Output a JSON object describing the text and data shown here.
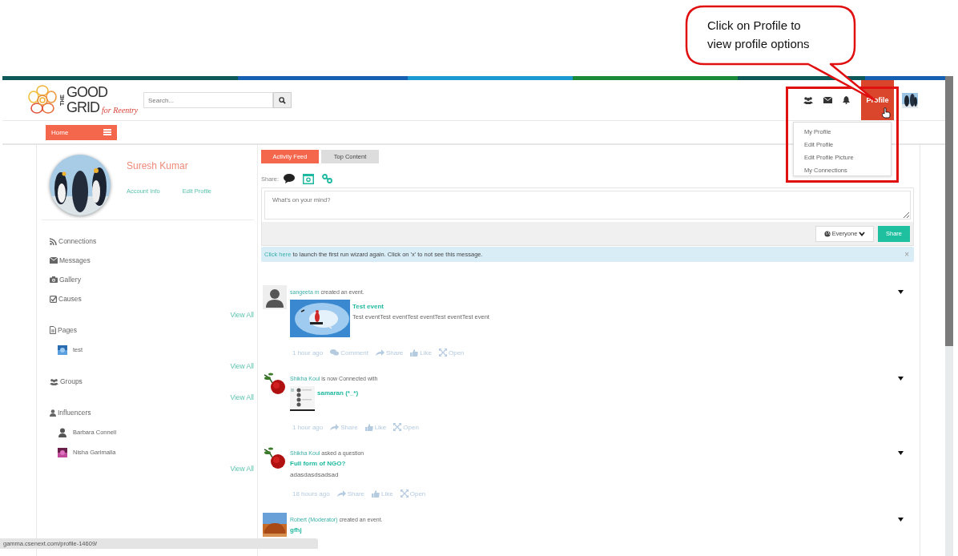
{
  "callout": {
    "lines": [
      "Click on Profile to",
      "view profile options"
    ]
  },
  "header": {
    "logo": {
      "top": "THE",
      "line1": "GOOD",
      "line2": "GRID",
      "tagline": "for Reentry"
    },
    "search": {
      "placeholder": "Search..."
    },
    "profile_button": {
      "label": "Profile",
      "selected": true
    },
    "profile_menu": [
      "My Profile",
      "Edit Profile",
      "Edit Profile Picture",
      "My Connections"
    ]
  },
  "nav": {
    "home": "Home"
  },
  "profile": {
    "name": "Suresh Kumar",
    "links": [
      "Account Info",
      "Edit Profile"
    ]
  },
  "sidebar": {
    "sections": [
      {
        "label": "Connections"
      },
      {
        "label": "Messages"
      },
      {
        "label": "Gallery"
      },
      {
        "label": "Causes",
        "view_all": "View All"
      },
      {
        "label": "Pages",
        "items": [
          {
            "name": "test"
          }
        ],
        "view_all": "View All"
      },
      {
        "label": "Groups",
        "view_all": "View All"
      },
      {
        "label": "Influencers",
        "items": [
          {
            "name": "Barbara Connell"
          },
          {
            "name": "Nisha Garimalla"
          }
        ],
        "view_all": "View All"
      }
    ]
  },
  "tabs": [
    {
      "label": "Activity Feed",
      "selected": true
    },
    {
      "label": "Top Content",
      "selected": false
    }
  ],
  "composer": {
    "share_label": "Share:",
    "placeholder": "What's on your mind?",
    "audience": "Everyone",
    "submit": "Share"
  },
  "notice": {
    "link": "Click here",
    "text": "to launch the first run wizard again. Click on 'x' to not see this message.",
    "close": "×"
  },
  "posts": [
    {
      "author": "sangeeta m",
      "action": "created an event.",
      "title": "Test event",
      "body": "Test eventTest eventTest eventTest eventTest event",
      "actions": [
        {
          "kind": "time",
          "label": "1 hour ago"
        },
        {
          "kind": "comment",
          "label": "Comment"
        },
        {
          "kind": "share",
          "label": "Share"
        },
        {
          "kind": "like",
          "label": "Like"
        },
        {
          "kind": "open",
          "label": "Open"
        }
      ]
    },
    {
      "author": "Shikha Koul",
      "action": "is now Connected with",
      "title": "samaran (*_*)",
      "actions": [
        {
          "kind": "time",
          "label": "1 hour ago"
        },
        {
          "kind": "share",
          "label": "Share"
        },
        {
          "kind": "like",
          "label": "Like"
        },
        {
          "kind": "open",
          "label": "Open"
        }
      ]
    },
    {
      "author": "Shikha Koul",
      "action": "asked a question",
      "title": "Full form of NGO?",
      "body": "adasdasdsadsad",
      "actions": [
        {
          "kind": "time",
          "label": "18 hours ago"
        },
        {
          "kind": "share",
          "label": "Share"
        },
        {
          "kind": "like",
          "label": "Like"
        },
        {
          "kind": "open",
          "label": "Open"
        }
      ]
    },
    {
      "author": "Robert (Moderator)",
      "action": "created an event.",
      "title": "gfhj"
    }
  ],
  "status_bar": "gamma.csenext.com/profile-14609/"
}
